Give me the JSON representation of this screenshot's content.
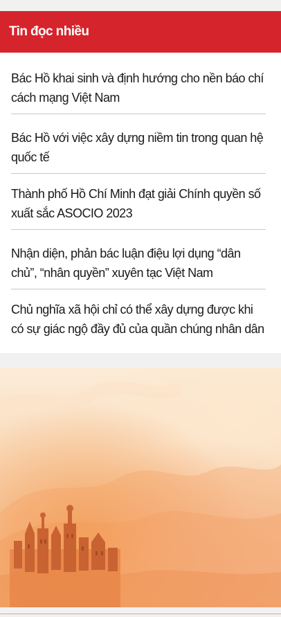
{
  "widget": {
    "title": "Tin đọc nhiều",
    "items": [
      {
        "title": "Bác Hồ khai sinh và định hướng cho nền báo chí cách mạng Việt Nam"
      },
      {
        "title": "Bác Hồ với việc xây dựng niềm tin trong quan hệ quốc tế"
      },
      {
        "title": "Thành phố Hồ Chí Minh đạt giải Chính quyền số xuất sắc ASOCIO 2023"
      },
      {
        "title": "Nhận diện, phản bác luận điệu lợi dụng “dân chủ”, “nhân quyền” xuyên tạc Việt Nam"
      },
      {
        "title": "Chủ nghĩa xã hội chỉ có thể xây dựng được khi có sự giác ngộ đầy đủ của quần chúng nhân dân"
      }
    ]
  },
  "colors": {
    "header_red": "#d6242c",
    "banner_orange": "#f08a3c",
    "banner_cream": "#fcecd8"
  },
  "banner": {
    "illustration": "watercolor-city-skyline"
  }
}
